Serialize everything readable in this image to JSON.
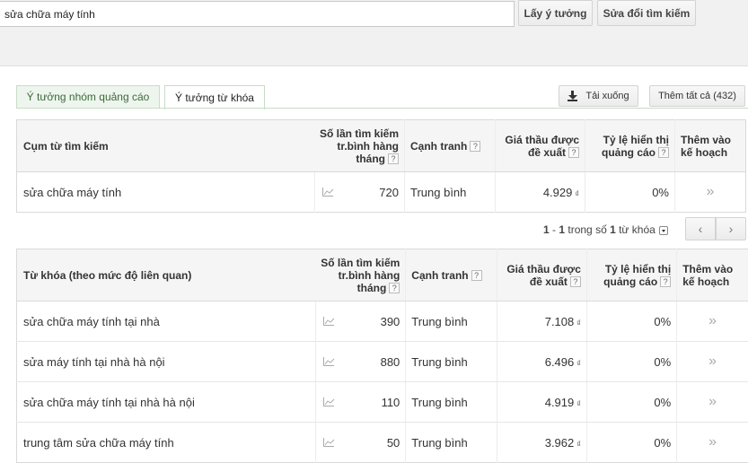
{
  "search": {
    "value": "sửa chữa máy tính"
  },
  "toolbar": {
    "get_ideas_label": "Lấy ý tưởng",
    "edit_search_label": "Sửa đổi tìm kiếm"
  },
  "tabs": [
    {
      "label": "Ý tưởng nhóm quảng cáo",
      "active": false
    },
    {
      "label": "Ý tưởng từ khóa",
      "active": true
    }
  ],
  "actions": {
    "download_label": "Tải xuống",
    "add_all_label": "Thêm tất cả (432)"
  },
  "headers": {
    "term": "Cụm từ tìm kiếm",
    "keyword": "Từ khóa (theo mức độ liên quan)",
    "volume_line1": "Số lần tìm kiếm",
    "volume_line2": "tr.bình hàng",
    "volume_line3": "tháng",
    "competition": "Cạnh tranh",
    "bid_line1": "Giá thầu được",
    "bid_line2": "đề xuất",
    "share_line1": "Tỷ lệ hiển thị",
    "share_line2": "quảng cáo",
    "add_line1": "Thêm vào",
    "add_line2": "kế hoạch",
    "help": "?"
  },
  "currency_symbol": "₫",
  "add_symbol": "»",
  "search_terms": [
    {
      "term": "sửa chữa máy tính",
      "volume": "720",
      "competition": "Trung bình",
      "bid": "4.929",
      "share": "0%"
    }
  ],
  "pager": {
    "start": "1",
    "end": "1",
    "middle": " trong số ",
    "total": "1",
    "suffix": " từ khóa",
    "prev": "‹",
    "next": "›"
  },
  "keywords": [
    {
      "term": "sửa chữa máy tính tại nhà",
      "volume": "390",
      "competition": "Trung bình",
      "bid": "7.108",
      "share": "0%"
    },
    {
      "term": "sửa máy tính tại nhà hà nội",
      "volume": "880",
      "competition": "Trung bình",
      "bid": "6.496",
      "share": "0%"
    },
    {
      "term": "sửa chữa máy tính tại nhà hà nội",
      "volume": "110",
      "competition": "Trung bình",
      "bid": "4.919",
      "share": "0%"
    },
    {
      "term": "trung tâm sửa chữa máy tính",
      "volume": "50",
      "competition": "Trung bình",
      "bid": "3.962",
      "share": "0%"
    }
  ]
}
